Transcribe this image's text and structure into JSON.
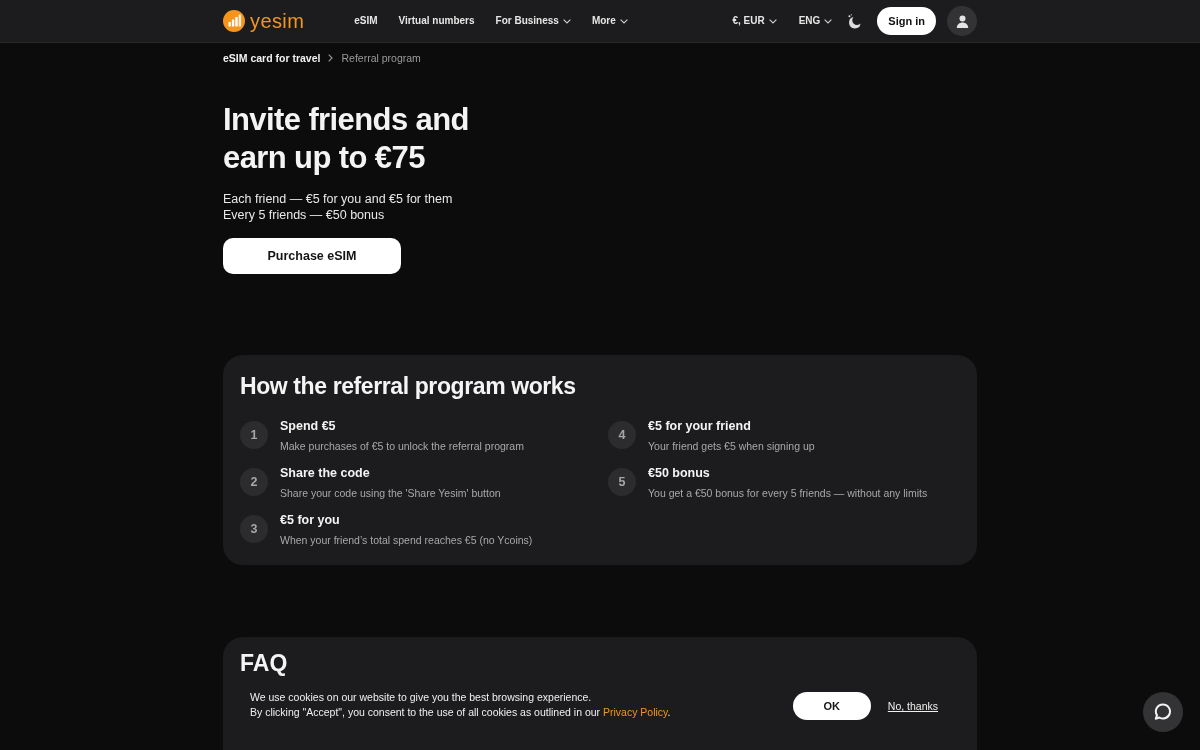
{
  "header": {
    "logo": "yesim",
    "nav": [
      {
        "label": "eSIM",
        "dropdown": false
      },
      {
        "label": "Virtual numbers",
        "dropdown": false
      },
      {
        "label": "For Business",
        "dropdown": true
      },
      {
        "label": "More",
        "dropdown": true
      }
    ],
    "currency": "€, EUR",
    "language": "ENG",
    "sign_in": "Sign in"
  },
  "breadcrumb": [
    {
      "label": "eSIM card for travel",
      "current": false
    },
    {
      "label": "Referral program",
      "current": true
    }
  ],
  "hero": {
    "title_lines": [
      "Invite friends and",
      "earn up to €75"
    ],
    "subtitle_lines": [
      "Each friend — €5 for you and €5 for them",
      "Every 5 friends — €50 bonus"
    ],
    "button": "Purchase eSIM"
  },
  "referral_steps": {
    "title": "How the referral program works",
    "steps": [
      {
        "number": "1",
        "title": "Spend €5",
        "description": "Make purchases of €5 to unlock the referral program"
      },
      {
        "number": "2",
        "title": "Share the code",
        "description": "Share your code using the 'Share Yesim' button"
      },
      {
        "number": "3",
        "title": "€5 for you",
        "description": "When your friend’s total spend reaches €5 (no Ycoins)"
      },
      {
        "number": "4",
        "title": "€5 for your friend",
        "description": "Your friend gets €5 when signing up"
      },
      {
        "number": "5",
        "title": "€50 bonus",
        "description": "You get a €50 bonus for every 5 friends — without any limits"
      }
    ]
  },
  "faq": {
    "title": "FAQ"
  },
  "cookie_banner": {
    "message": "We use cookies on our website to give you the best browsing experience.",
    "consent_text": "By clicking \"Accept\", you consent to the use of all cookies as outlined in our",
    "link": "Privacy Policy",
    "end": ".",
    "accept": "OK",
    "decline": "No, thanks"
  }
}
